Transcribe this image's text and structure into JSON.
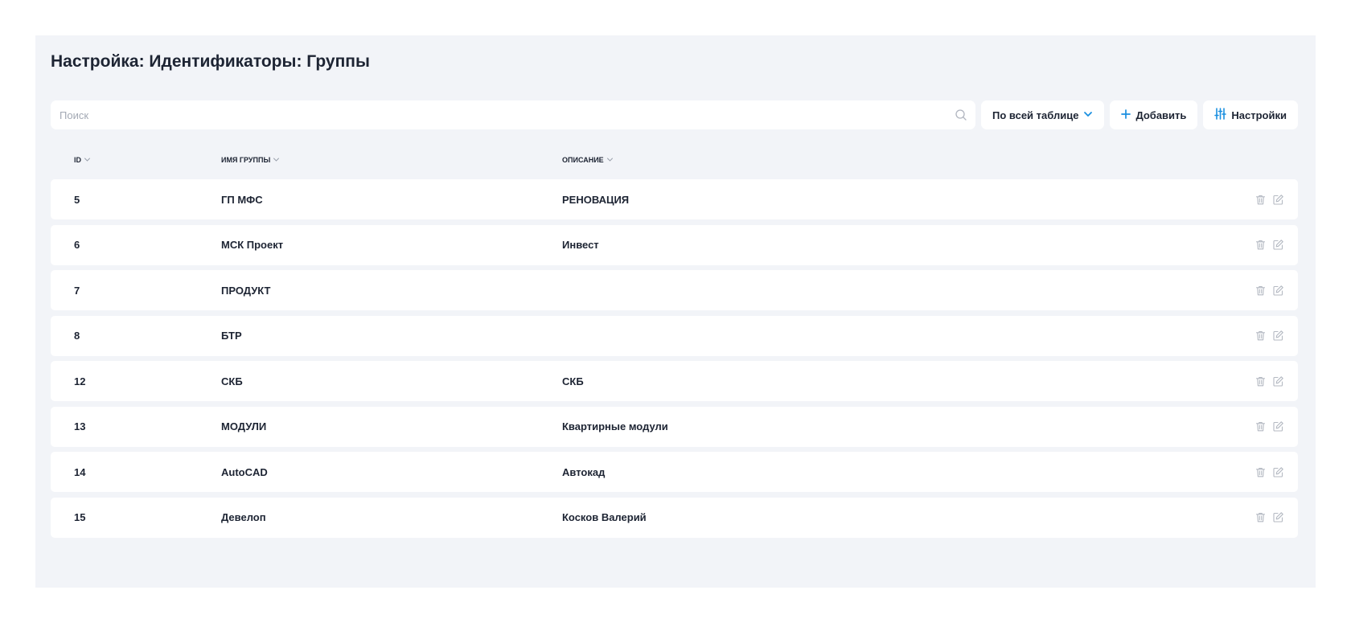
{
  "page": {
    "title": "Настройка: Идентификаторы: Группы"
  },
  "toolbar": {
    "search_placeholder": "Поиск",
    "scope_label": "По всей таблице",
    "add_label": "Добавить",
    "settings_label": "Настройки",
    "accent_color": "#1a8fe0"
  },
  "table": {
    "columns": [
      {
        "label": "ID"
      },
      {
        "label": "Имя группы"
      },
      {
        "label": "Описание"
      }
    ],
    "rows": [
      {
        "id": "5",
        "name": "ГП МФС",
        "description": "РЕНОВАЦИЯ"
      },
      {
        "id": "6",
        "name": "МСК Проект",
        "description": "Инвест"
      },
      {
        "id": "7",
        "name": "ПРОДУКТ",
        "description": ""
      },
      {
        "id": "8",
        "name": "БТР",
        "description": ""
      },
      {
        "id": "12",
        "name": "СКБ",
        "description": "СКБ"
      },
      {
        "id": "13",
        "name": "МОДУЛИ",
        "description": "Квартирные модули"
      },
      {
        "id": "14",
        "name": "AutoCAD",
        "description": "Автокад"
      },
      {
        "id": "15",
        "name": "Девелоп",
        "description": "Косков Валерий"
      }
    ],
    "row_actions": [
      "trash-icon",
      "edit-icon"
    ]
  }
}
